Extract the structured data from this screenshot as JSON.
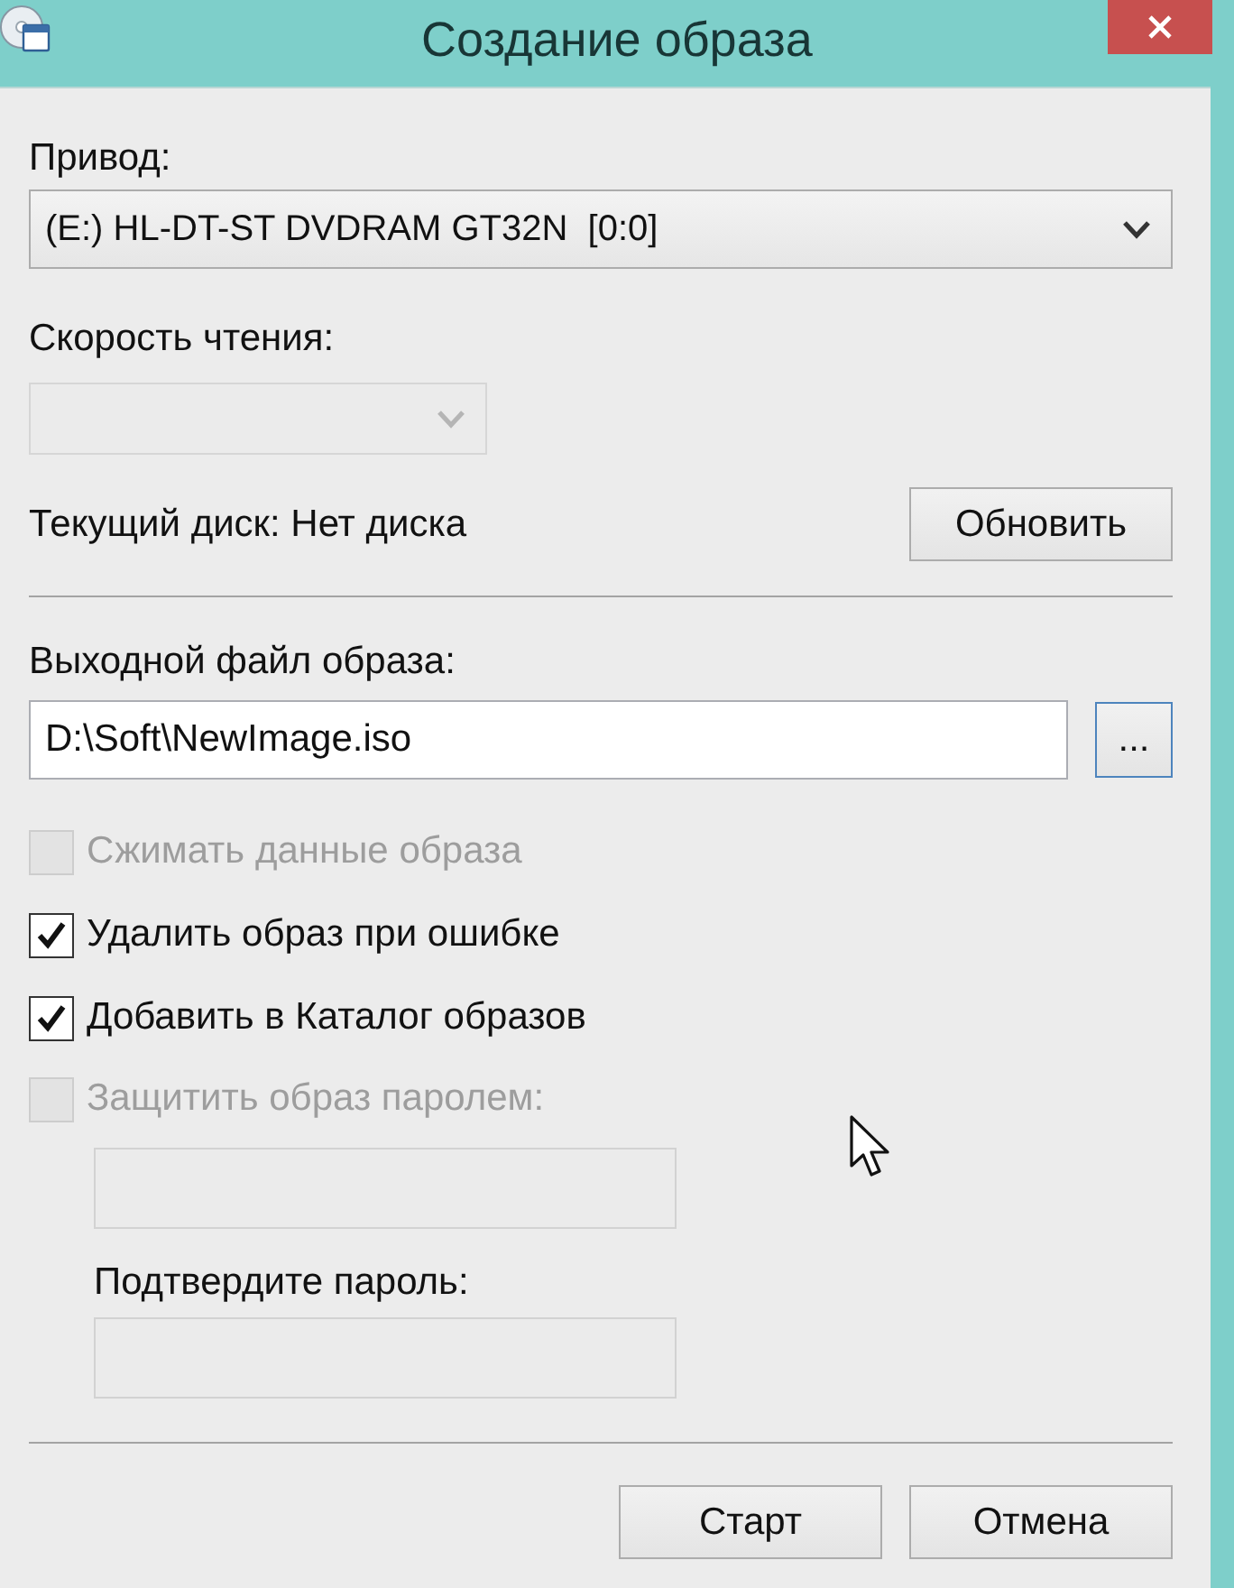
{
  "window": {
    "title": "Создание образа"
  },
  "drive": {
    "label": "Привод:",
    "value": "(E:) HL-DT-ST DVDRAM GT32N  [0:0]"
  },
  "read_speed": {
    "label": "Скорость чтения:",
    "disabled": true
  },
  "current_disc": {
    "text": "Текущий диск: Нет диска",
    "refresh_button": "Обновить"
  },
  "output_file": {
    "label": "Выходной файл образа:",
    "value": "D:\\Soft\\NewImage.iso",
    "browse_button": "..."
  },
  "options": [
    {
      "label": "Сжимать данные образа",
      "checked": false,
      "disabled": true
    },
    {
      "label": "Удалить образ при ошибке",
      "checked": true,
      "disabled": false
    },
    {
      "label": "Добавить в Каталог образов",
      "checked": true,
      "disabled": false
    },
    {
      "label": "Защитить образ паролем:",
      "checked": false,
      "disabled": true
    }
  ],
  "password": {
    "disabled": true
  },
  "confirm_password": {
    "label": "Подтвердите пароль:",
    "disabled": true
  },
  "buttons": [
    "Старт",
    "Отмена"
  ]
}
